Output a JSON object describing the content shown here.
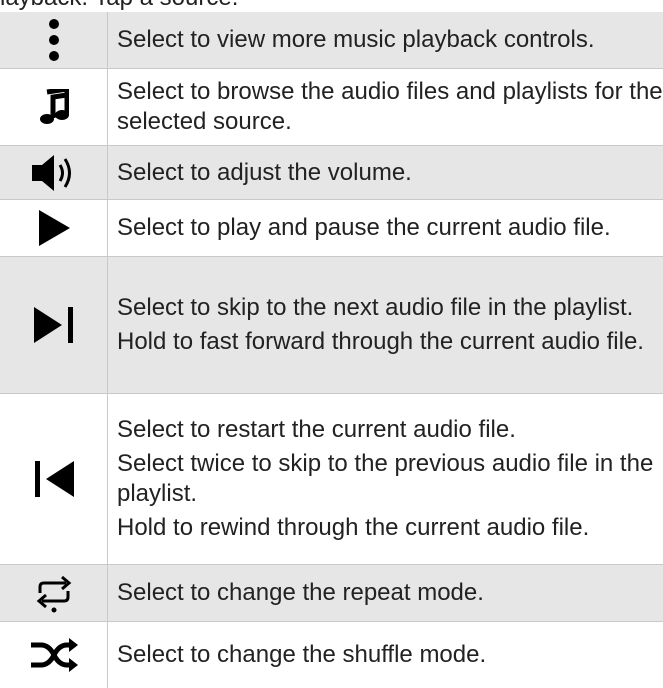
{
  "header": {
    "text": "layback. Tap a source."
  },
  "rows": [
    {
      "icon": "more-vertical-icon",
      "lines": [
        "Select to view more music playback controls."
      ]
    },
    {
      "icon": "music-note-icon",
      "lines": [
        "Select to browse the audio files and playlists for the selected source."
      ]
    },
    {
      "icon": "volume-icon",
      "lines": [
        "Select to adjust the volume."
      ]
    },
    {
      "icon": "play-icon",
      "lines": [
        "Select to play and pause the current audio file."
      ]
    },
    {
      "icon": "skip-next-icon",
      "lines": [
        "Select to skip to the next audio file in the playlist.",
        "Hold to fast forward through the current audio file."
      ]
    },
    {
      "icon": "skip-previous-icon",
      "lines": [
        "Select to restart the current audio file.",
        "Select twice to skip to the previous audio file in the playlist.",
        "Hold to rewind through the current audio file."
      ]
    },
    {
      "icon": "repeat-icon",
      "lines": [
        "Select to change the repeat mode."
      ]
    },
    {
      "icon": "shuffle-icon",
      "lines": [
        "Select to change the shuffle mode."
      ]
    }
  ],
  "colors": {
    "shade": "#e6e6e6",
    "border": "#c9c9c9",
    "icon": "#000000",
    "text": "#222222"
  }
}
